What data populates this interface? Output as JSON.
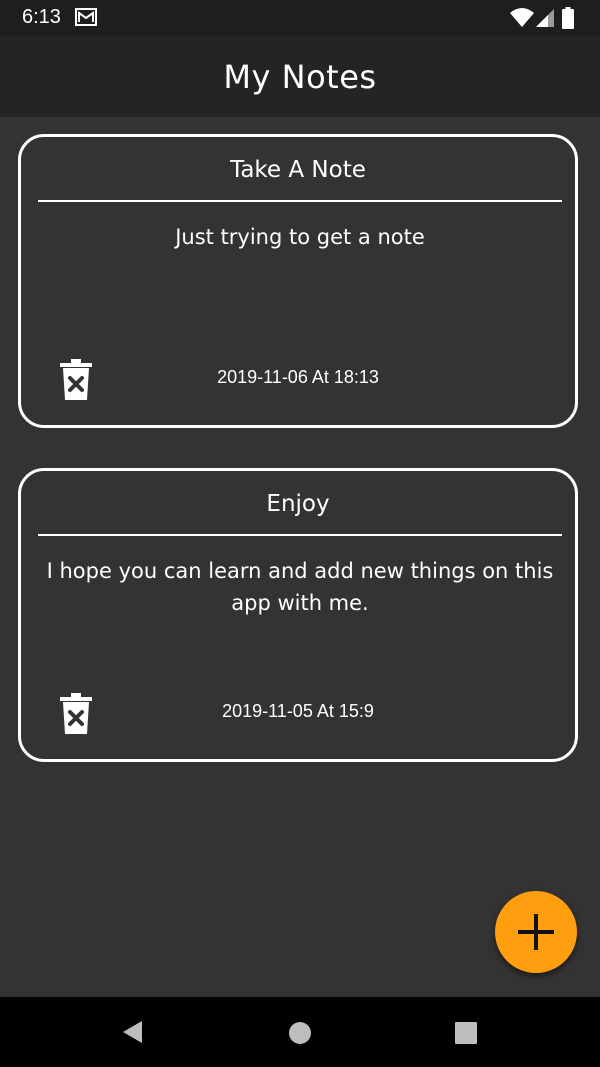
{
  "status_bar": {
    "time": "6:13",
    "icons": [
      "mail-icon",
      "wifi-icon",
      "signal-icon",
      "battery-icon"
    ]
  },
  "app_bar": {
    "title": "My Notes"
  },
  "notes": [
    {
      "title": "Take A Note",
      "body": "Just trying to get a note",
      "date": "2019-11-06 At 18:13"
    },
    {
      "title": "Enjoy",
      "body": "I hope you can learn and add new things on this app with me.",
      "date": "2019-11-05 At 15:9"
    }
  ],
  "fab": {
    "icon": "plus-icon",
    "color": "#ff9e0f"
  },
  "nav_bar": {
    "icons": [
      "back-icon",
      "home-icon",
      "recents-icon"
    ]
  }
}
